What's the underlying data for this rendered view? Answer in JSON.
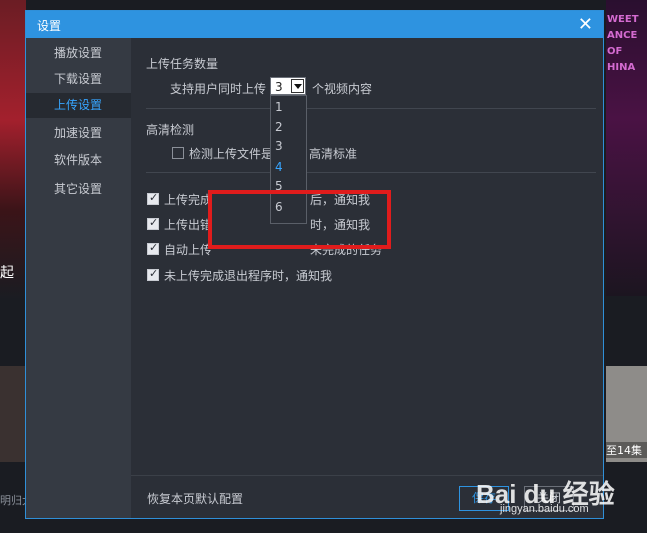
{
  "background": {
    "left_text": "起",
    "left_caption": "明归大",
    "right_text": "WEET\nANCE\nOF\nHINA",
    "right_caption": "至14集"
  },
  "dialog": {
    "title": "设置",
    "close": "✕"
  },
  "sidebar": {
    "items": [
      {
        "label": "播放设置"
      },
      {
        "label": "下载设置"
      },
      {
        "label": "上传设置"
      },
      {
        "label": "加速设置"
      },
      {
        "label": "软件版本"
      },
      {
        "label": "其它设置"
      }
    ],
    "active_index": 2
  },
  "upload": {
    "task_title": "上传任务数量",
    "concurrent_prefix": "支持用户同时上传",
    "concurrent_value": "3",
    "concurrent_suffix": "个视频内容",
    "options": [
      "1",
      "2",
      "3",
      "4",
      "5",
      "6"
    ],
    "hovered_option": "4",
    "hd_title": "高清检测",
    "hd_check_label_a": "检测上传文件是",
    "hd_check_label_b": "高清标准",
    "checks": [
      {
        "label_a": "上传完成",
        "label_b": "后，通知我",
        "checked": true
      },
      {
        "label_a": "上传出错",
        "label_b": "时，通知我",
        "checked": true
      },
      {
        "label_a": "自动上传",
        "label_b": "未完成的任务",
        "checked": true
      },
      {
        "label": "未上传完成退出程序时，通知我",
        "checked": true
      }
    ]
  },
  "footer": {
    "restore_label": "恢复本页默认配置",
    "save_label": "保存",
    "cancel_label": "关闭"
  },
  "watermark": {
    "brand": "Bai du 经验",
    "url": "jingyan.baidu.com"
  },
  "colors": {
    "accent": "#2e93e0",
    "highlight": "#e01c1c",
    "active_nav": "#37a5ff"
  }
}
